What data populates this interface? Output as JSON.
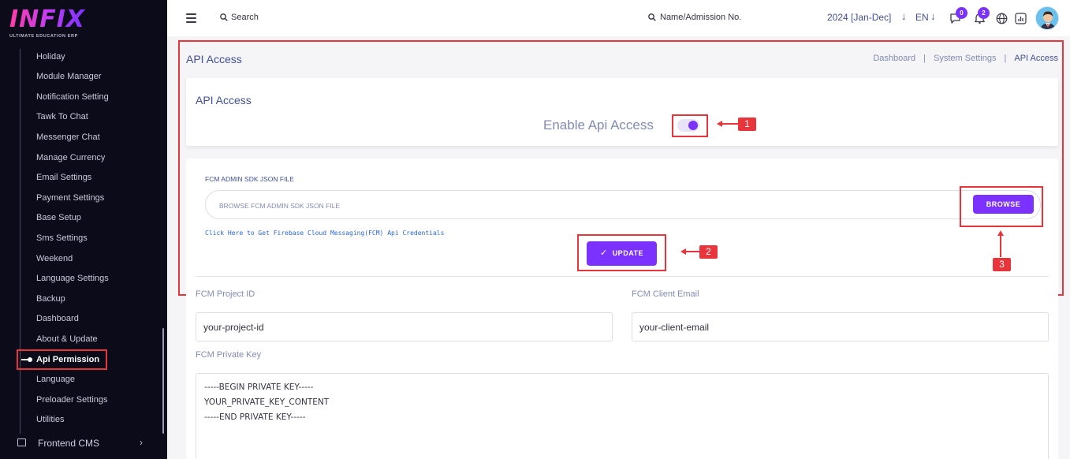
{
  "brand": {
    "logo_text": "INFIX",
    "tagline": "ULTIMATE EDUCATION ERP"
  },
  "sidebar": {
    "items": [
      {
        "label": "Holiday"
      },
      {
        "label": "Module Manager"
      },
      {
        "label": "Notification Setting"
      },
      {
        "label": "Tawk To Chat"
      },
      {
        "label": "Messenger Chat"
      },
      {
        "label": "Manage Currency"
      },
      {
        "label": "Email Settings"
      },
      {
        "label": "Payment Settings"
      },
      {
        "label": "Base Setup"
      },
      {
        "label": "Sms Settings"
      },
      {
        "label": "Weekend"
      },
      {
        "label": "Language Settings"
      },
      {
        "label": "Backup"
      },
      {
        "label": "Dashboard"
      },
      {
        "label": "About & Update"
      },
      {
        "label": "Api Permission"
      },
      {
        "label": "Language"
      },
      {
        "label": "Preloader Settings"
      },
      {
        "label": "Utilities"
      }
    ],
    "active_item": "Api Permission",
    "frontend_label": "Frontend CMS"
  },
  "header": {
    "search_label": "Search",
    "student_search_label": "Name/Admission No.",
    "session_label": "2024 [Jan-Dec]",
    "language_label": "EN",
    "chat_badge": "0",
    "notification_badge": "2"
  },
  "page": {
    "title": "API Access",
    "breadcrumbs": [
      "Dashboard",
      "System Settings",
      "API Access"
    ]
  },
  "api_card": {
    "title": "API Access",
    "enable_label": "Enable Api Access",
    "enabled": true
  },
  "fcm_form": {
    "file_label": "FCM ADMIN SDK JSON FILE",
    "file_placeholder": "BROWSE FCM ADMIN SDK JSON FILE",
    "browse_label": "BROWSE",
    "link_text": "Click Here to Get Firebase Cloud Messaging(FCM) Api Credentials",
    "update_label": "UPDATE",
    "project_id_label": "FCM Project ID",
    "project_id_value": "your-project-id",
    "client_email_label": "FCM Client Email",
    "client_email_value": "your-client-email",
    "private_key_label": "FCM Private Key",
    "private_key_lines": [
      "-----BEGIN PRIVATE KEY-----",
      "YOUR_PRIVATE_KEY_CONTENT",
      "-----END PRIVATE KEY-----"
    ]
  },
  "annotations": {
    "one": "1",
    "two": "2",
    "three": "3"
  },
  "colors": {
    "accent": "#7c32ff",
    "highlight": "#e8353b",
    "sidebar_bg": "#0b0b1a"
  }
}
